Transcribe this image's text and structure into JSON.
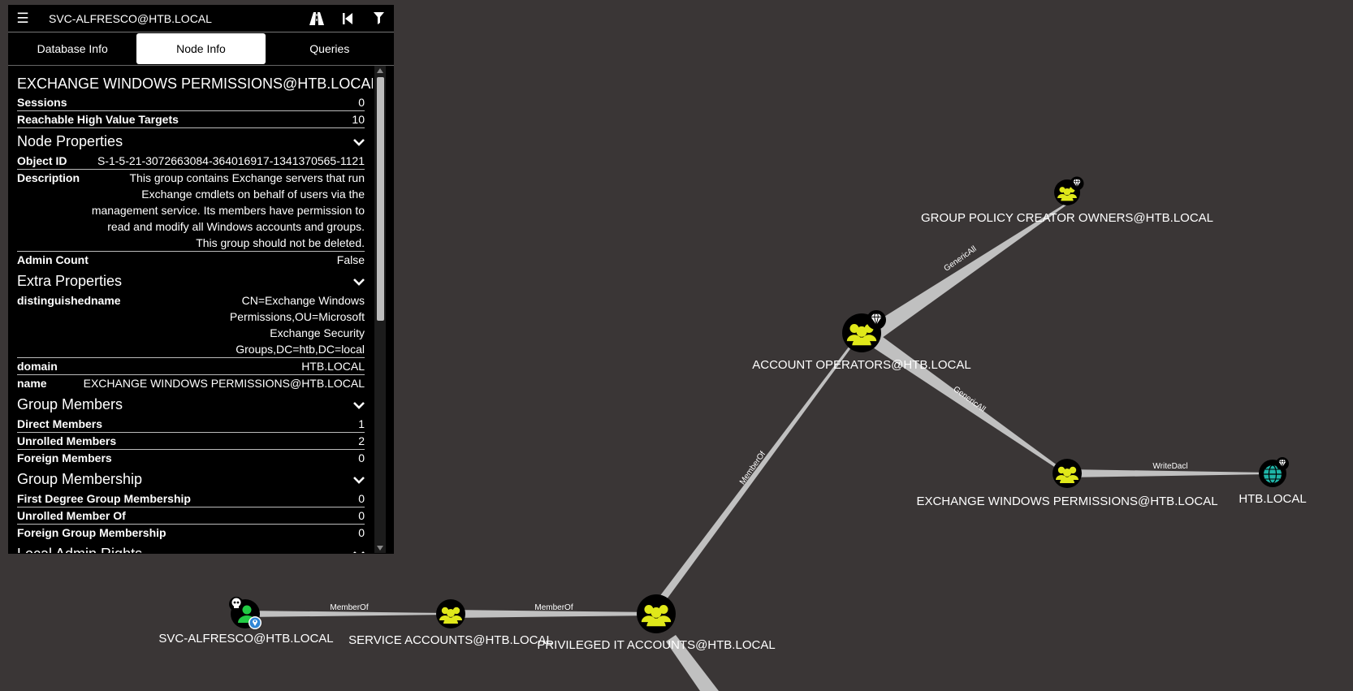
{
  "colors": {
    "background": "#3a3636",
    "node_yellow": "#e0e81a",
    "edge": "#c0c0c0",
    "domain_teal": "#1fb5a8",
    "user_green": "#22cc44"
  },
  "header": {
    "search_value": "SVC-ALFRESCO@HTB.LOCAL"
  },
  "tabs": [
    {
      "label": "Database Info",
      "active": false
    },
    {
      "label": "Node Info",
      "active": true
    },
    {
      "label": "Queries",
      "active": false
    }
  ],
  "node": {
    "title": "EXCHANGE WINDOWS PERMISSIONS@HTB.LOCAL",
    "overview": [
      {
        "key": "Sessions",
        "value": "0"
      },
      {
        "key": "Reachable High Value Targets",
        "value": "10"
      }
    ],
    "sections": {
      "node_properties": "Node Properties",
      "extra_properties": "Extra Properties",
      "group_members": "Group Members",
      "group_membership": "Group Membership",
      "local_admin_rights": "Local Admin Rights"
    },
    "node_properties": [
      {
        "key": "Object ID",
        "value": "S-1-5-21-3072663084-364016917-1341370565-1121"
      },
      {
        "key": "Description",
        "value": "This group contains Exchange servers that run Exchange cmdlets on behalf of users via the management service. Its members have permission to read and modify all Windows accounts and groups. This group should not be deleted."
      },
      {
        "key": "Admin Count",
        "value": "False"
      }
    ],
    "extra_properties": [
      {
        "key": "distinguishedname",
        "value": "CN=Exchange Windows Permissions,OU=Microsoft Exchange Security Groups,DC=htb,DC=local"
      },
      {
        "key": "domain",
        "value": "HTB.LOCAL"
      },
      {
        "key": "name",
        "value": "EXCHANGE WINDOWS PERMISSIONS@HTB.LOCAL"
      }
    ],
    "group_members": [
      {
        "key": "Direct Members",
        "value": "1"
      },
      {
        "key": "Unrolled Members",
        "value": "2"
      },
      {
        "key": "Foreign Members",
        "value": "0"
      }
    ],
    "group_membership": [
      {
        "key": "First Degree Group Membership",
        "value": "0"
      },
      {
        "key": "Unrolled Member Of",
        "value": "0"
      },
      {
        "key": "Foreign Group Membership",
        "value": "0"
      }
    ]
  },
  "graph": {
    "nodes": {
      "svc_alfresco": "SVC-ALFRESCO@HTB.LOCAL",
      "service_accounts": "SERVICE ACCOUNTS@HTB.LOCAL",
      "privileged_it": "PRIVILEGED IT ACCOUNTS@HTB.LOCAL",
      "account_operators": "ACCOUNT OPERATORS@HTB.LOCAL",
      "gpco": "GROUP POLICY CREATOR OWNERS@HTB.LOCAL",
      "exchange_wp": "EXCHANGE WINDOWS PERMISSIONS@HTB.LOCAL",
      "htb_local": "HTB.LOCAL"
    },
    "edges": {
      "svc_to_service": "MemberOf",
      "service_to_priv": "MemberOf",
      "priv_to_accops": "MemberOf",
      "accops_to_gpco": "GenericAll",
      "accops_to_exch": "GenericAll",
      "exch_to_htb": "WriteDacl"
    }
  }
}
